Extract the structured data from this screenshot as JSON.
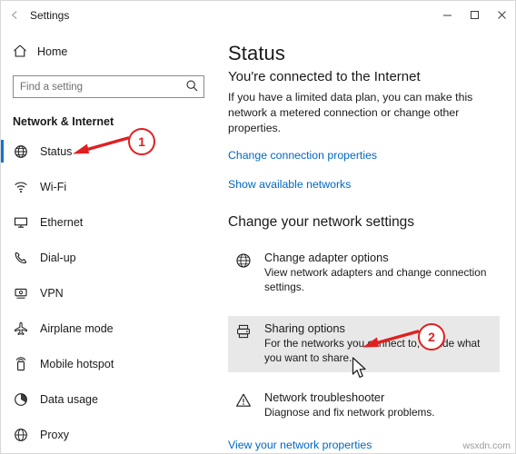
{
  "window": {
    "title": "Settings",
    "back_icon": "back-arrow-icon",
    "controls": {
      "minimize": "─",
      "maximize": "□",
      "close": "✕"
    }
  },
  "sidebar": {
    "home_label": "Home",
    "home_icon": "home-icon",
    "search": {
      "placeholder": "Find a setting",
      "value": "",
      "icon": "search-icon"
    },
    "section_title": "Network & Internet",
    "items": [
      {
        "label": "Status",
        "icon": "status-globe-icon",
        "selected": true
      },
      {
        "label": "Wi-Fi",
        "icon": "wifi-icon",
        "selected": false
      },
      {
        "label": "Ethernet",
        "icon": "ethernet-icon",
        "selected": false
      },
      {
        "label": "Dial-up",
        "icon": "dialup-phone-icon",
        "selected": false
      },
      {
        "label": "VPN",
        "icon": "vpn-icon",
        "selected": false
      },
      {
        "label": "Airplane mode",
        "icon": "airplane-icon",
        "selected": false
      },
      {
        "label": "Mobile hotspot",
        "icon": "mobile-hotspot-icon",
        "selected": false
      },
      {
        "label": "Data usage",
        "icon": "data-usage-pie-icon",
        "selected": false
      },
      {
        "label": "Proxy",
        "icon": "proxy-globe-icon",
        "selected": false
      }
    ]
  },
  "main": {
    "page_title": "Status",
    "status_heading": "You're connected to the Internet",
    "status_body": "If you have a limited data plan, you can make this network a metered connection or change other properties.",
    "link_change_connection": "Change connection properties",
    "link_show_networks": "Show available networks",
    "settings_heading": "Change your network settings",
    "options": [
      {
        "title": "Change adapter options",
        "desc": "View network adapters and change connection settings.",
        "icon": "adapter-globe-icon",
        "highlighted": false
      },
      {
        "title": "Sharing options",
        "desc": "For the networks you connect to, decide what you want to share.",
        "icon": "sharing-options-icon",
        "highlighted": true
      },
      {
        "title": "Network troubleshooter",
        "desc": "Diagnose and fix network problems.",
        "icon": "warning-triangle-icon",
        "highlighted": false
      }
    ],
    "link_view_properties": "View your network properties"
  },
  "annotations": {
    "badges": [
      {
        "number": "1"
      },
      {
        "number": "2"
      }
    ],
    "accent_color": "#e02020",
    "cursor": "mouse-pointer"
  },
  "watermark": "wsxdn.com"
}
